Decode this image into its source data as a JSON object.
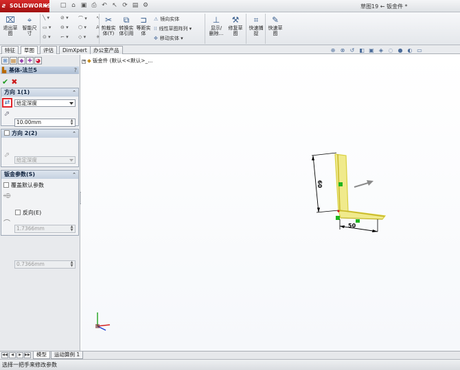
{
  "app": {
    "logo_text": "SOLIDWORKS",
    "doc_title": "草图19 ← 钣金件 *"
  },
  "ribbon": {
    "exit_sketch": "退出草\n图",
    "smart_dim": "智能尺\n寸",
    "trim": "剪裁实\n体(T)",
    "convert": "转换实\n体引用",
    "offset": "等距实\n体",
    "mirror": "镜向实体",
    "linear_pattern": "线性草图阵列",
    "move": "移动实体",
    "display_delete": "显示/\n删除...",
    "repair": "修复草\n图",
    "quick_snap": "快速捕\n捉",
    "rapid_sketch": "快速草\n图"
  },
  "tabs": [
    "特征",
    "草图",
    "评估",
    "DimXpert",
    "办公室产品"
  ],
  "active_tab": 1,
  "tree_flyout": "钣金件 (默认<<默认>_...",
  "property_manager": {
    "title": "基体-法兰5",
    "help": "?",
    "direction1": {
      "title": "方向 1(1)",
      "end_condition": "给定深度",
      "depth": "10.00mm"
    },
    "direction2": {
      "title": "方向 2(2)",
      "end_condition": "给定深度",
      "depth": ""
    },
    "sheet_metal": {
      "title": "钣金参数(S)",
      "override_label": "覆盖默认参数",
      "thickness": "1.7366mm",
      "reverse_label": "反向(E)",
      "radius": "0.7366mm"
    }
  },
  "sketch": {
    "dim_vertical": "60",
    "dim_horizontal": "50",
    "colors": {
      "profile": "#d8d040",
      "fill": "#f0ea8c",
      "dim": "#000000",
      "relation": "#1fb51f",
      "arrow": "#8a8a8a"
    }
  },
  "bottom_tabs": [
    "模型",
    "运动算例 1"
  ],
  "status": "选择一把手来修改参数"
}
